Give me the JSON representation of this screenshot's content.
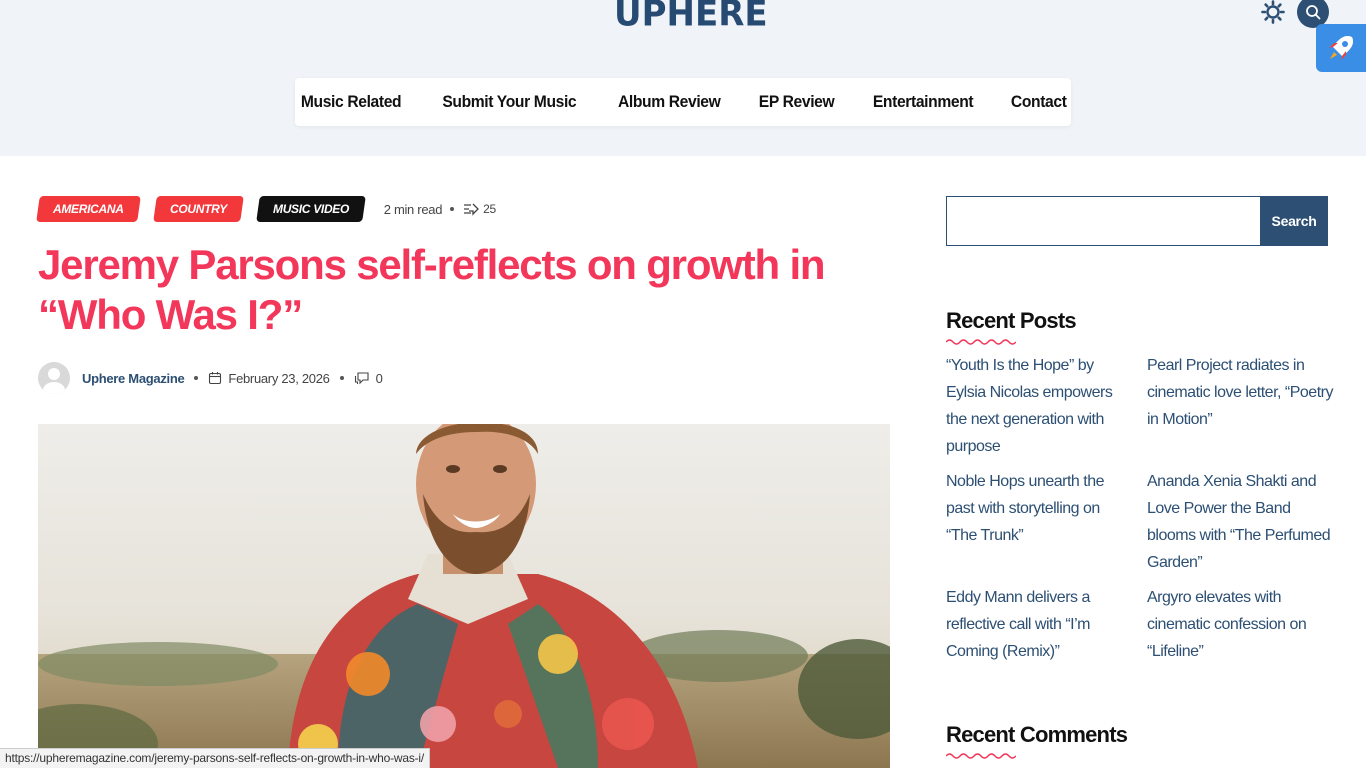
{
  "header": {
    "logo": "UpHere",
    "theme_icon": "sun-gear-icon",
    "search_icon": "search-icon",
    "rocket_icon": "rocket-icon"
  },
  "nav": {
    "items": [
      "Music Related",
      "Submit Your Music",
      "Album Review",
      "EP Review",
      "Entertainment",
      "Contact"
    ]
  },
  "article": {
    "tags": [
      "AMERICANA",
      "COUNTRY",
      "MUSIC VIDEO"
    ],
    "read_time": "2 min read",
    "views": "25",
    "title": "Jeremy Parsons self-reflects on growth in “Who Was I?”",
    "author": "Uphere Magazine",
    "date": "February 23, 2026",
    "comments": "0"
  },
  "sidebar": {
    "search_button": "Search",
    "search_placeholder": "",
    "recent_posts_title": "Recent Posts",
    "recent_posts": [
      "“Youth Is the Hope” by Eylsia Nicolas empowers the next generation with purpose",
      "Pearl Project radiates in cinematic love letter, “Poetry in Motion”",
      "Noble Hops unearth the past with storytelling on “The Trunk”",
      "Ananda Xenia Shakti and Love Power the Band blooms with “The Perfumed Garden”",
      "Eddy Mann delivers a reflective call with “I’m Coming (Remix)”",
      "Argyro elevates with cinematic confession on “Lifeline”"
    ],
    "recent_comments_title": "Recent Comments"
  },
  "status_bar": {
    "url": "https://upheremagazine.com/jeremy-parsons-self-reflects-on-growth-in-who-was-i/"
  },
  "colors": {
    "accent_red": "#f2375a",
    "tag_red": "#f2383b",
    "navy": "#2c4f73",
    "header_bg": "#f0f4f8",
    "rocket_blue": "#3a8ee6"
  }
}
